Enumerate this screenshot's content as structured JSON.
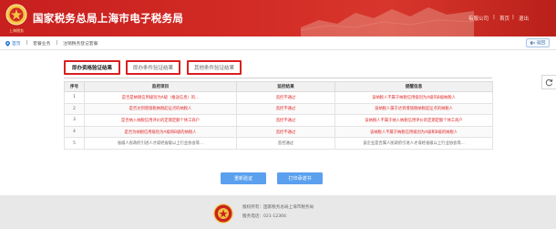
{
  "header": {
    "logo_text": "上海税务",
    "site_title": "国家税务总局上海市电子税务局",
    "links": [
      "有服公司",
      "首页",
      "退出"
    ],
    "brand_color": "#c81f1f"
  },
  "breadcrumb": {
    "home_icon": "location-pin-icon",
    "items": [
      "首页",
      "套餐业务",
      "注销税务登记套餐"
    ],
    "back_label": "返回"
  },
  "tabs": [
    {
      "label": "即办资格验证结果",
      "active": true
    },
    {
      "label": "即办条件验证结果",
      "active": false
    },
    {
      "label": "其他条件验证结果",
      "active": false
    }
  ],
  "table": {
    "headers": [
      "序号",
      "监控项目",
      "监控结果",
      "提醒信息"
    ],
    "rows": [
      {
        "no": "1",
        "item": "是否是纳税信用级别为A级（推送信息）的...",
        "result": "监控不通过",
        "info": "该纳税人不属于纳税信用级别为A级的B级纳税人",
        "status": "fail"
      },
      {
        "no": "2",
        "item": "是否达到增值税纳税起征点的纳税人",
        "result": "监控不通过",
        "info": "该纳税人属于达到增值税纳税起征点的纳税人",
        "status": "fail"
      },
      {
        "no": "3",
        "item": "是否纳入纳税信用评价的定期定额个体工商户",
        "result": "监控不通过",
        "info": "该纳税人不属于纳入纳税信用评价的定期定额个体工商户",
        "status": "fail"
      },
      {
        "no": "4",
        "item": "是否为纳税信用级别为A级和B级的纳税人",
        "result": "监控不通过",
        "info": "该纳税人不属于纳税信用级别为A级和B级的纳税人",
        "status": "fail"
      },
      {
        "no": "5",
        "item": "省级人民政府引进人才或经省级以上行业协会等...",
        "result": "监控通过",
        "info": "该企业是否属人民政府引进人才或经省级以上行业协会等...",
        "status": "pass"
      }
    ]
  },
  "buttons": {
    "revalidate": "重新验证",
    "print": "打印承诺书",
    "color": "#5aa0ef"
  },
  "side_tool_icon": "refresh-icon",
  "footer": {
    "emblem_icon": "tax-emblem-icon",
    "line1": "版权所有：国家税务总局上海市税务局",
    "line2": "服务电话：021-12366"
  }
}
